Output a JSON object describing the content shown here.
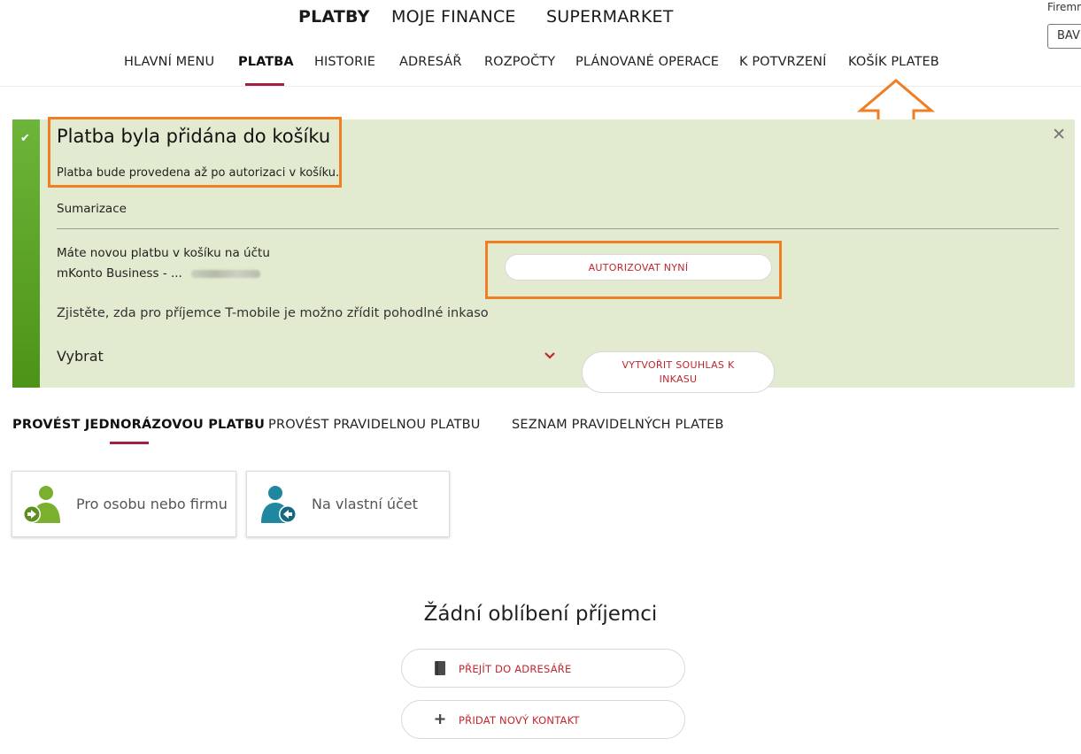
{
  "header": {
    "main_tabs": [
      {
        "label": "PLATBY",
        "active": true
      },
      {
        "label": "MOJE FINANCE",
        "active": false
      },
      {
        "label": "SUPERMARKET",
        "active": false
      }
    ],
    "corner_label": "Firemní",
    "corner_button": "BAV"
  },
  "subnav": {
    "items": [
      {
        "label": "HLAVNÍ MENU"
      },
      {
        "label": "PLATBA",
        "active": true
      },
      {
        "label": "HISTORIE"
      },
      {
        "label": "ADRESÁŘ"
      },
      {
        "label": "ROZPOČTY"
      },
      {
        "label": "PLÁNOVANÉ OPERACE"
      },
      {
        "label": "K POTVRZENÍ"
      },
      {
        "label": "KOŠÍK PLATEB"
      }
    ]
  },
  "alert": {
    "title": "Platba byla přidána do košíku",
    "description": "Platba bude provedena až po autorizaci v košíku.",
    "summary_label": "Sumarizace",
    "cart_line1": "Máte novou platbu v košíku na účtu",
    "cart_line2": "mKonto Business - ...",
    "authorize_button": "AUTORIZOVAT NYNÍ",
    "inkaso_text": "Zjistěte, zda pro příjemce T-mobile je možno zřídit pohodlné inkaso",
    "select_value": "Vybrat",
    "consent_button_line1": "VYTVOŘIT SOUHLAS K",
    "consent_button_line2": "INKASU",
    "success_color": "#5fa52a",
    "background_color": "#e2ebcf"
  },
  "payment_tabs": [
    {
      "label": "PROVÉST JEDNORÁZOVOU PLATBU",
      "active": true
    },
    {
      "label": "PROVÉST PRAVIDELNOU PLATBU"
    },
    {
      "label": "SEZNAM PRAVIDELNÝCH PLATEB"
    }
  ],
  "cards": [
    {
      "label": "Pro osobu nebo firmu",
      "icon": "person-arrow-right-icon",
      "color": "#7ab02d"
    },
    {
      "label": "Na vlastní účet",
      "icon": "person-arrow-left-icon",
      "color": "#1f87a0"
    }
  ],
  "favorites": {
    "empty_title": "Žádní oblíbení příjemci",
    "address_book_button": "PŘEJÍT DO ADRESÁŘE",
    "add_contact_button": "PŘIDAT NOVÝ KONTAKT"
  },
  "colors": {
    "accent": "#a3213f",
    "link_red": "#c0272d",
    "annotation": "#f07f24"
  }
}
